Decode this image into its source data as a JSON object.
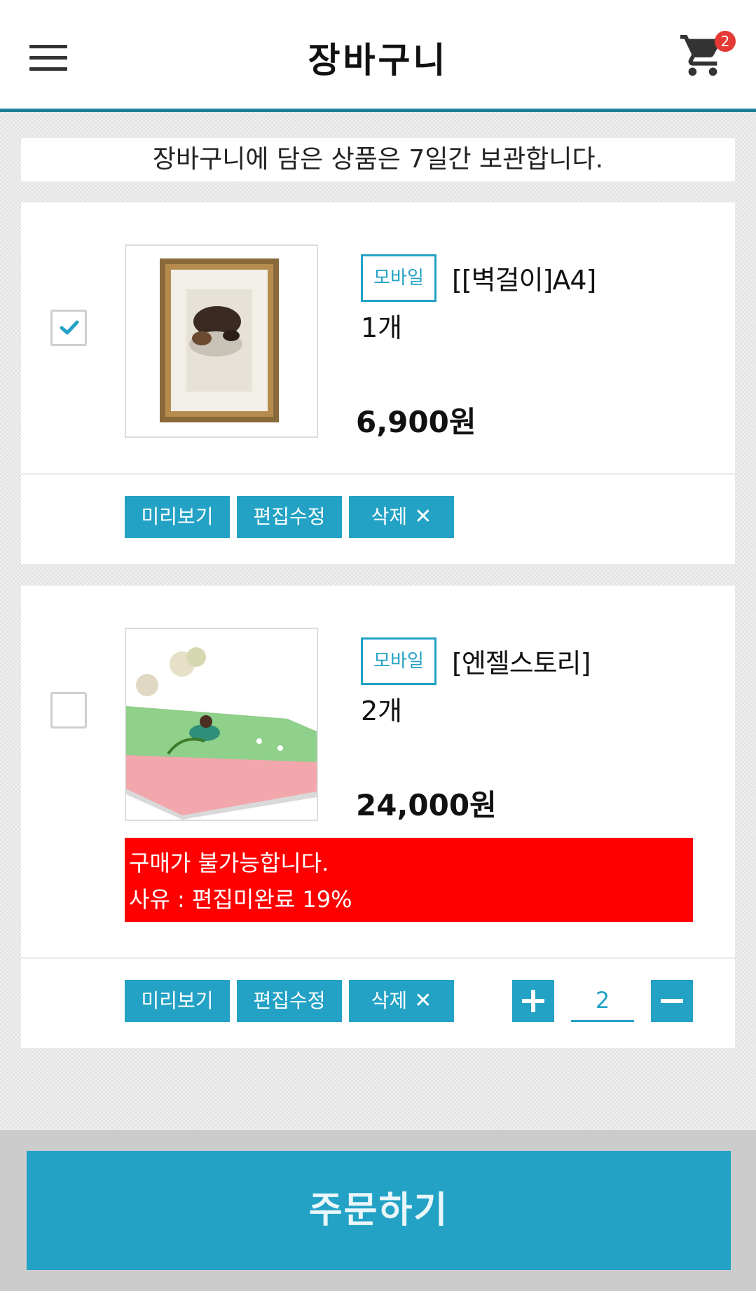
{
  "header": {
    "title": "장바구니",
    "cart_count": "2"
  },
  "notice": "장바구니에 담은 상품은 7일간 보관합니다.",
  "items": [
    {
      "checked": true,
      "tag": "모바일",
      "name": "[[벽걸이]A4]",
      "qty_text": "1개",
      "price": "6,900원",
      "buttons": {
        "preview": "미리보기",
        "edit": "편집수정",
        "delete": "삭제"
      }
    },
    {
      "checked": false,
      "tag": "모바일",
      "name": "[엔젤스토리]",
      "qty_text": "2개",
      "price": "24,000원",
      "error": {
        "line1": "구매가 불가능합니다.",
        "line2": "사유 : 편집미완료 19%"
      },
      "buttons": {
        "preview": "미리보기",
        "edit": "편집수정",
        "delete": "삭제"
      },
      "quantity": "2"
    }
  ],
  "icons": {
    "delete": "close-icon",
    "plus": "plus-icon",
    "minus": "minus-icon",
    "menu": "hamburger-icon",
    "cart": "cart-icon",
    "check": "checkmark-icon"
  },
  "colors": {
    "accent": "#23a2c6",
    "header_line": "#1f7f99",
    "error": "#ff0000",
    "badge": "#e53935"
  },
  "footer": {
    "order_label": "주문하기"
  }
}
